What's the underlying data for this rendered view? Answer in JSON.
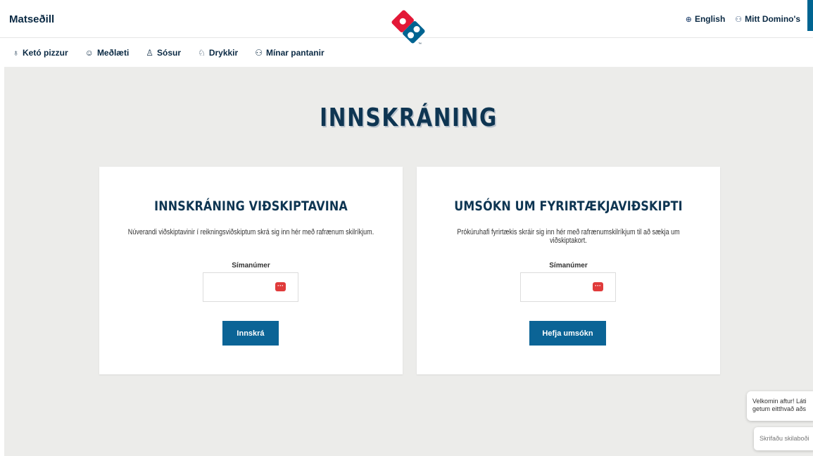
{
  "header": {
    "menu_label": "Matseðill",
    "language_label": "English",
    "account_label": "Mitt Domino's",
    "logo_tm": "™"
  },
  "subnav": {
    "items": [
      {
        "icon": "keto-icon",
        "label": "Ketó pizzur"
      },
      {
        "icon": "sides-icon",
        "label": "Meðlæti"
      },
      {
        "icon": "sauce-icon",
        "label": "Sósur"
      },
      {
        "icon": "drink-icon",
        "label": "Drykkir"
      },
      {
        "icon": "orders-icon",
        "label": "Mínar pantanir"
      }
    ]
  },
  "page": {
    "title": "INNSKRÁNING"
  },
  "cards": {
    "customer": {
      "title": "INNSKRÁNING VIÐSKIPTAVINA",
      "description": "Núverandi viðskiptavinir í reikningsviðskiptum skrá sig inn hér með rafrænum skilríkjum.",
      "field_label": "Símanúmer",
      "field_value": "",
      "button_label": "Innskrá"
    },
    "business": {
      "title": "UMSÓKN UM FYRIRTÆKJAVIÐSKIPTI",
      "description": "Prókúruhafi fyrirtækis skráir sig inn hér með rafrænumskilríkjum til að sækja um viðskiptakort.",
      "field_label": "Símanúmer",
      "field_value": "",
      "button_label": "Hefja umsókn"
    }
  },
  "chat": {
    "greeting_line1": "Velkomin aftur! Láti",
    "greeting_line2": "getum eitthvað aðs",
    "input_placeholder": "Skrifaðu skilaboði"
  },
  "colors": {
    "brand_blue": "#006491",
    "brand_red": "#e31837",
    "navy_text": "#0b2a44",
    "background": "#ececea"
  }
}
